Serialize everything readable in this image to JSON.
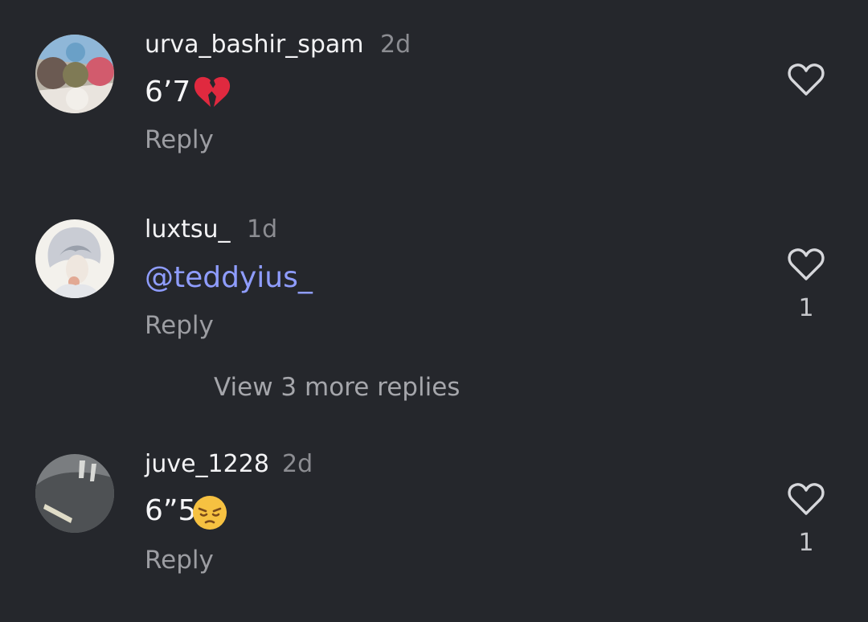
{
  "comments": [
    {
      "username": "urva_bashir_spam",
      "time": "2d",
      "text": "6’7",
      "emoji": "broken-heart-emoji",
      "reply_label": "Reply",
      "like_count": ""
    },
    {
      "username": "luxtsu_",
      "time": "1d",
      "text": "@teddyius_",
      "reply_label": "Reply",
      "like_count": "1"
    },
    {
      "username": "juve_1228",
      "time": "2d",
      "text": "6”5",
      "emoji": "pensive-face-emoji",
      "reply_label": "Reply",
      "like_count": "1"
    }
  ],
  "view_more_replies": "View 3 more replies",
  "icons": {
    "like": "heart-outline-icon"
  },
  "colors": {
    "background": "#25272c",
    "mention": "#8f9dff",
    "secondary_text": "#9c9da2"
  }
}
